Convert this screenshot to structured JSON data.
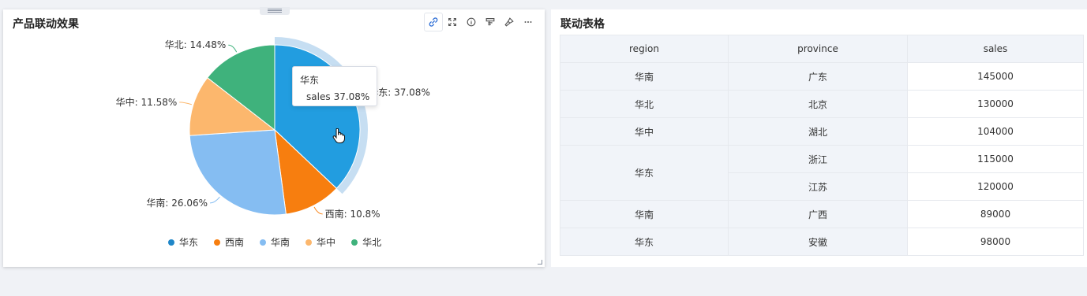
{
  "left_card": {
    "title": "产品联动效果",
    "toolbar": [
      {
        "name": "link-icon"
      },
      {
        "name": "fullscreen-icon"
      },
      {
        "name": "info-icon"
      },
      {
        "name": "filter-icon"
      },
      {
        "name": "brush-icon"
      },
      {
        "name": "more-icon"
      }
    ],
    "tooltip": {
      "title": "华东",
      "series": "sales",
      "value": "37.08%",
      "color": "#1f86c8"
    },
    "legend": [
      {
        "label": "华东",
        "color": "#1f86c8"
      },
      {
        "label": "西南",
        "color": "#f77e0f"
      },
      {
        "label": "华南",
        "color": "#85bdf2"
      },
      {
        "label": "华中",
        "color": "#fcb76d"
      },
      {
        "label": "华北",
        "color": "#3fb27c"
      }
    ]
  },
  "chart_data": {
    "type": "pie",
    "title": "产品联动效果",
    "series_name": "sales",
    "slices": [
      {
        "label": "华东",
        "percent": 37.08,
        "text": "华东: 37.08%",
        "color": "#229de0",
        "highlighted": true
      },
      {
        "label": "西南",
        "percent": 10.8,
        "text": "西南: 10.8%",
        "color": "#f77e0f"
      },
      {
        "label": "华南",
        "percent": 26.06,
        "text": "华南: 26.06%",
        "color": "#85bdf2"
      },
      {
        "label": "华中",
        "percent": 11.58,
        "text": "华中: 11.58%",
        "color": "#fcb76d"
      },
      {
        "label": "华北",
        "percent": 14.48,
        "text": "华北: 14.48%",
        "color": "#3fb27c"
      }
    ]
  },
  "right_card": {
    "title": "联动表格",
    "columns": [
      "region",
      "province",
      "sales"
    ],
    "rows": [
      {
        "region": "华南",
        "province": "广东",
        "sales": "145000"
      },
      {
        "region": "华北",
        "province": "北京",
        "sales": "130000"
      },
      {
        "region": "华中",
        "province": "湖北",
        "sales": "104000"
      },
      {
        "region": "华东",
        "province": "浙江",
        "sales": "115000"
      },
      {
        "region": "",
        "province": "江苏",
        "sales": "120000"
      },
      {
        "region": "华南",
        "province": "广西",
        "sales": "89000"
      },
      {
        "region": "华东",
        "province": "安徽",
        "sales": "98000"
      }
    ]
  }
}
